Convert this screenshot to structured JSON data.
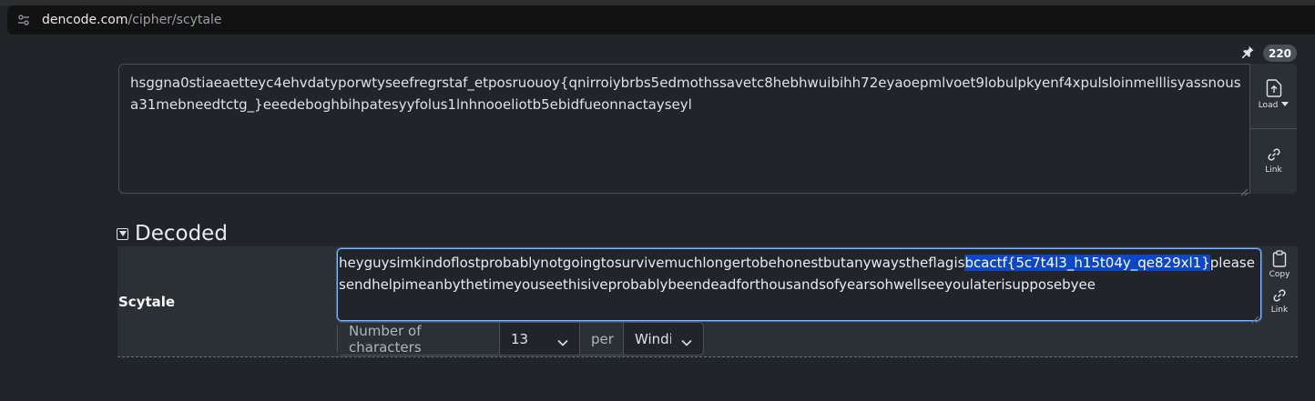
{
  "browser": {
    "url_domain": "dencode.com",
    "url_path": "/cipher/scytale"
  },
  "toolbar": {
    "badge_count": "220"
  },
  "input": {
    "value": "hsggna0stiaeaetteyc4ehvdatyporwtyseefregrstaf_etposruouoy{qnirroiybrbs5edmothssavetc8hebhwuibihh72eyaoepmlvoet9lobulpkyenf4xpulsloinmelllisyassnousa31mebneedtctg_}eeedeboghbihpatesyyfolus1lnhnooeliotb5ebidfueonnactayseyl",
    "load_label": "Load",
    "link_label": "Link"
  },
  "decoded": {
    "title": "Decoded",
    "row_label": "Scytale",
    "output_before": "heyguysimkindoflostprobablynotgoingtosurvivemuchlongertobehonestbutanywaystheflagis",
    "output_selected": "bcactf{5c7t4l3_h15t04y_qe829xl1}",
    "output_after": "pleasesendhelpimeanbythetimeyouseethisiveprobablybeendeadforthousandsofyearsohwellseeyoulaterisupposebyee",
    "copy_label": "Copy",
    "link_label": "Link",
    "options": {
      "number_label": "Number of characters",
      "number_value": "13",
      "per_label": "per",
      "wind_value": "Winding"
    }
  },
  "icons": {
    "site_info": "site-info-icon",
    "pin": "pin-icon",
    "load": "upload-icon",
    "link": "link-icon",
    "copy": "clipboard-icon",
    "toggle": "caret-down-icon",
    "select": "chevron-down-icon"
  },
  "colors": {
    "selection": "#0d47c5",
    "focus_border": "#86b7fe",
    "background": "#212529",
    "panel": "#2b3035"
  }
}
